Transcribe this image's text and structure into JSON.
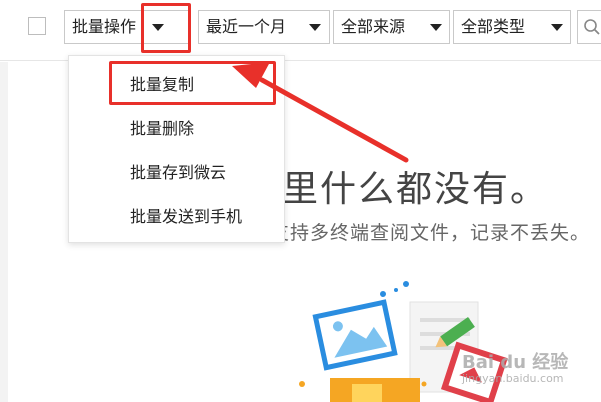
{
  "toolbar": {
    "batch_ops": "批量操作",
    "time_filter": "最近一个月",
    "source_filter": "全部来源",
    "type_filter": "全部类型"
  },
  "menu": {
    "items": [
      {
        "label": "批量复制"
      },
      {
        "label": "批量删除"
      },
      {
        "label": "批量存到微云"
      },
      {
        "label": "批量发送到手机"
      }
    ]
  },
  "empty_state": {
    "title": "这里什么都没有。",
    "subtitle": "支持多终端查阅文件，记录不丢失。"
  },
  "watermark": {
    "text": "Bai du 经验",
    "sub": "jingyan.baidu.com"
  },
  "colors": {
    "annotation_red": "#e8302a",
    "caret": "#222222"
  }
}
